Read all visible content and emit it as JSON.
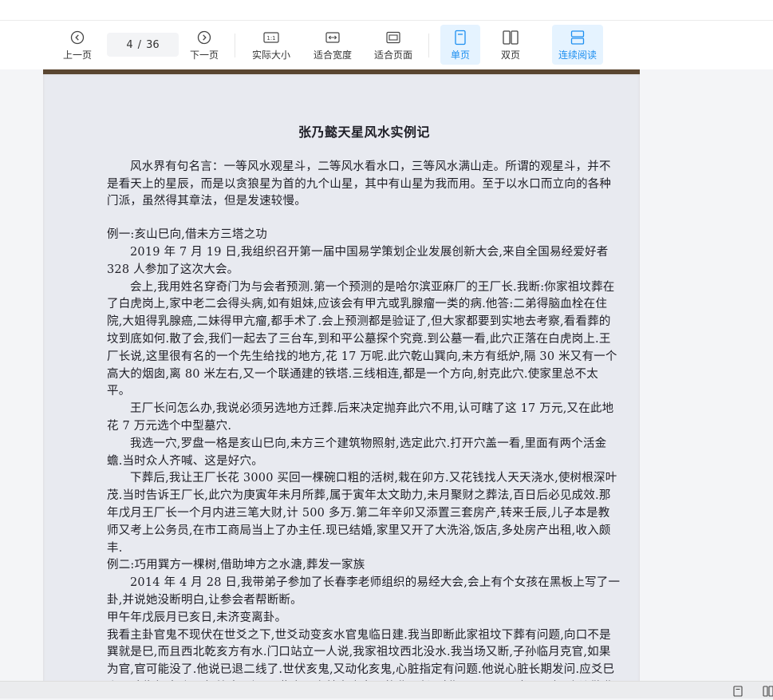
{
  "toolbar": {
    "prev": "上一页",
    "page_current": "4",
    "page_sep": "/",
    "page_total": "36",
    "next": "下一页",
    "actual_size": "实际大小",
    "fit_width": "适合宽度",
    "fit_page": "适合页面",
    "single_page": "单页",
    "double_page": "双页",
    "continuous": "连续阅读",
    "actual_size_glyph": "1:1"
  },
  "colors": {
    "accent": "#1d8ff0",
    "active_bg": "#e5f3ff"
  },
  "document": {
    "title": "张乃懿天星风水实例记",
    "paragraphs": [
      {
        "text": "风水界有句名言：一等风水观星斗，二等风水看水口，三等风水满山走。所谓的观星斗，并不是看天上的星辰，而是以贪狼星为首的九个山星，其中有山星为我而用。至于以水口而立向的各种门派，虽然得其章法，但是发速较慢。",
        "style": "ind"
      },
      {
        "text": "例一:亥山巳向,借未方三塔之功",
        "style": "gap"
      },
      {
        "text": "2019 年 7 月 19 日,我组织召开第一届中国易学策划企业发展创新大会,来自全国易经爱好者 328 人参加了这次大会。",
        "style": "ind"
      },
      {
        "text": "会上,我用姓名穿奇门为与会者预测.第一个预测的是哈尔滨亚麻厂的王厂长.我断:你家祖坟葬在了白虎岗上,家中老二会得头病,如有姐妹,应该会有甲亢或乳腺瘤一类的病.他答:二弟得脑血栓在住院,大姐得乳腺癌,二妹得甲亢瘤,都手术了.会上预测都是验证了,但大家都要到实地去考察,看看葬的坟到底如何.散了会,我们一起去了三台车,到和平公墓探个究竟.到公墓一看,此穴正落在白虎岗上.王厂长说,这里很有名的一个先生给找的地方,花 17 万呢.此穴乾山巽向,未方有纸炉,隔 30 米又有一个高大的烟囱,离 80 米左右,又一个联通建的铁塔.三线相连,都是一个方向,射克此穴.使家里总不太平。",
        "style": "ind"
      },
      {
        "text": "王厂长问怎么办,我说必须另选地方迁葬.后来决定抛弃此穴不用,认可瞎了这 17 万元,又在此地花 7 万元选个中型墓穴.",
        "style": "ind"
      },
      {
        "text": "我选一穴,罗盘一格是亥山巳向,未方三个建筑物照射,选定此穴.打开穴盖一看,里面有两个活金蟾.当时众人齐喊、这是好穴。",
        "style": "ind"
      },
      {
        "text": "下葬后,我让王厂长花 3000 买回一棵碗口粗的活树,栽在卯方.又花钱找人天天浇水,使树根深叶茂.当时告诉王厂长,此穴为庚寅年未月所葬,属于寅年太文助力,未月聚财之葬法,百日后必见成效.那年戊月王厂长一个月内进三笔大财,计 500 多万.第二年辛卯又添置三套房产,转来壬辰,儿子本是教师又考上公务员,在市工商局当上了办主任.现已结婚,家里又开了大洗浴,饭店,多处房产出租,收入颇丰.",
        "style": "ind"
      },
      {
        "text": "例二:巧用巽方一棵树,借助坤方之水溏,葬发一家族",
        "style": ""
      },
      {
        "text": "2014 年 4 月 28 日,我带弟子参加了长春李老师组织的易经大会,会上有个女孩在黑板上写了一卦,并说她没断明白,让参会者帮断断。",
        "style": "ind"
      },
      {
        "text": "甲午年戊辰月已亥日,未济变离卦。",
        "style": ""
      },
      {
        "text": "我看主卦官鬼不现伏在世爻之下,世爻动变亥水官鬼临日建.我当即断此家祖坟下葬有问题,向口不是巽就是巳,而且西北乾亥方有水.门口站立一人说,我家祖坟西北没水.我当场又断,子孙临月克官,如果为官,官可能没了.他说已退二线了.世伏亥鬼,又动化亥鬼,心脏指定有问题.他说心脏长期发问.应爻巳火日破临勾陈,必是祖坟出了问题.此人是吉林省农安县的曲县长,叫曲再果 28 号当天下午,会议散曲县长出车到他的祖坟验地",
        "style": ""
      }
    ]
  },
  "status": {
    "single_icon": "page-icon",
    "double_icon": "double-page-icon"
  }
}
